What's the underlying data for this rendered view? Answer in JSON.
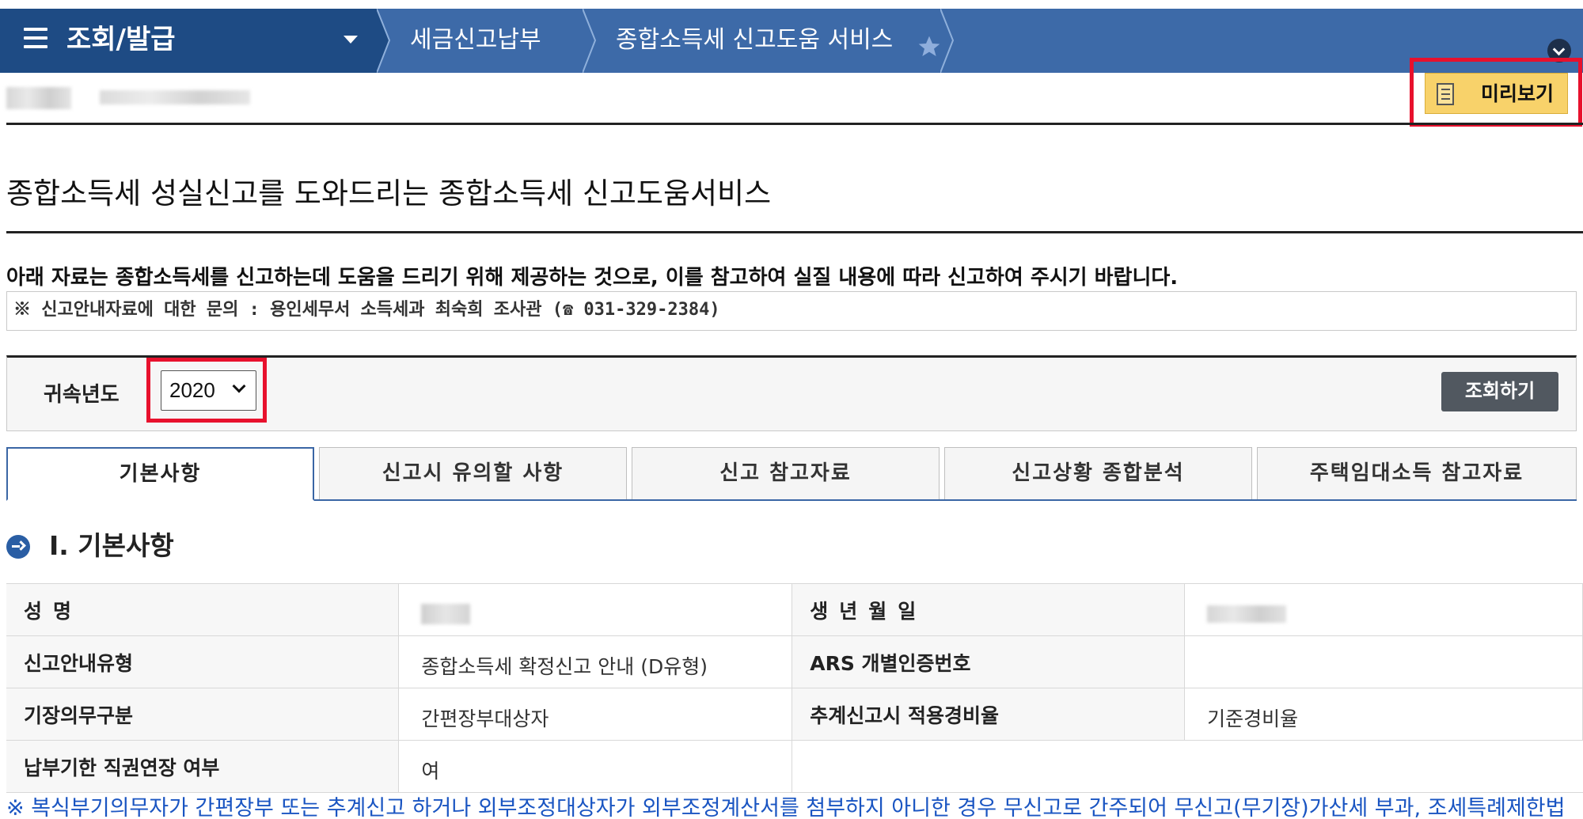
{
  "nav": {
    "menu_title": "조회/발급",
    "breadcrumbs": [
      "세금신고납부",
      "종합소득세 신고도움 서비스"
    ]
  },
  "header": {
    "preview_label": "미리보기"
  },
  "page": {
    "title": "종합소득세 성실신고를 도와드리는 종합소득세 신고도움서비스",
    "notice": "아래 자료는 종합소득세를 신고하는데 도움을 드리기 위해 제공하는 것으로, 이를 참고하여 실질 내용에 따라 신고하여 주시기 바랍니다.",
    "inquiry": "※ 신고안내자료에 대한 문의 : 용인세무서 소득세과 최숙희 조사관 (☎ 031-329-2384)"
  },
  "filter": {
    "label": "귀속년도",
    "year": "2020",
    "search_label": "조회하기"
  },
  "tabs": [
    {
      "label": "기본사항",
      "active": true
    },
    {
      "label": "신고시 유의할 사항",
      "active": false
    },
    {
      "label": "신고 참고자료",
      "active": false
    },
    {
      "label": "신고상황 종합분석",
      "active": false
    },
    {
      "label": "주택임대소득 참고자료",
      "active": false
    }
  ],
  "section": {
    "title": "Ⅰ. 기본사항"
  },
  "info": {
    "rows": [
      {
        "l1": "성명",
        "v1": "",
        "l2": "생년월일",
        "v2": ""
      },
      {
        "l1": "신고안내유형",
        "v1": "종합소득세 확정신고 안내 (D유형)",
        "l2": "ARS 개별인증번호",
        "v2": ""
      },
      {
        "l1": "기장의무구분",
        "v1": "간편장부대상자",
        "l2": "추계신고시 적용경비율",
        "v2": "기준경비율"
      },
      {
        "l1": "납부기한 직권연장 여부",
        "v1": "여"
      }
    ]
  },
  "footnote": "※ 복식부기의무자가 간편장부 또는 추계신고 하거나 외부조정대상자가 외부조정계산서를 첨부하지 아니한 경우 무신고로 간주되어 무신고(무기장)가산세 부과, 조세특례제한법"
}
